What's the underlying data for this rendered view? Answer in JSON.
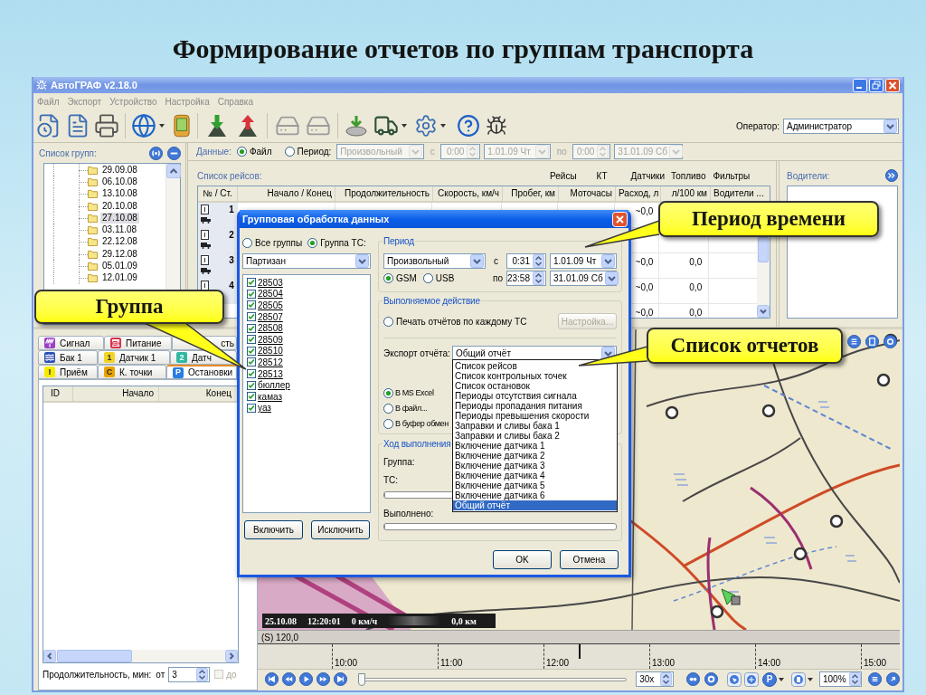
{
  "slide": {
    "title": "Формирование отчетов по группам транспорта"
  },
  "window": {
    "title": "АвтоГРАФ v2.18.0"
  },
  "menu": [
    "Файл",
    "Экспорт",
    "Устройство",
    "Настройка",
    "Справка"
  ],
  "toolbar": {
    "operator_label": "Оператор:",
    "operator": "Администратор"
  },
  "group_list": {
    "title": "Список групп:",
    "items": [
      {
        "label": "29.09.08",
        "selected": false
      },
      {
        "label": "06.10.08",
        "selected": false
      },
      {
        "label": "13.10.08",
        "selected": false
      },
      {
        "label": "20.10.08",
        "selected": false
      },
      {
        "label": "27.10.08",
        "selected": true
      },
      {
        "label": "03.11.08",
        "selected": false
      },
      {
        "label": "22.12.08",
        "selected": false
      },
      {
        "label": "29.12.08",
        "selected": false
      },
      {
        "label": "05.01.09",
        "selected": false
      },
      {
        "label": "12.01.09",
        "selected": false
      }
    ]
  },
  "data_bar": {
    "label": "Данные:",
    "sources": [
      {
        "label": "Файл",
        "selected": true
      },
      {
        "label": "Период:",
        "selected": false
      }
    ],
    "disabled": true,
    "period": "Произвольный",
    "from_label": "с",
    "from_time": "0:00",
    "from_date": "1.01.09 Чт",
    "to_label": "по",
    "to_time": "0:00",
    "to_date": "31.01.09 Сб"
  },
  "trips": {
    "title": "Список рейсов:",
    "column_groups": [
      "Рейсы",
      "КТ",
      "Датчики",
      "Топливо",
      "Фильтры"
    ],
    "columns": [
      "№ / Ст.",
      "Начало / Конец",
      "Продолжительность",
      "Скорость, км/ч",
      "Пробег, км",
      "Моточасы",
      "Расход, л",
      "л/100 км",
      "Водители ..."
    ],
    "rows": [
      {
        "number": "1",
        "fuel": "~0,0"
      },
      {
        "number": "2"
      },
      {
        "number": "3",
        "fuel": "~0,0",
        "per_100km": "0,0"
      },
      {
        "number": "4",
        "fuel": "~0,0",
        "per_100km": "0,0"
      },
      {
        "fuel": "~0,0",
        "per_100km": "0,0"
      }
    ]
  },
  "drivers": {
    "title": "Водители:"
  },
  "event_tabs": [
    [
      {
        "label": "Сигнал",
        "selected": false
      },
      {
        "label": "Питание",
        "selected": false
      },
      {
        "label": "сть",
        "selected": false,
        "cut_start": true
      }
    ],
    [
      {
        "label": "Бак 1",
        "selected": false
      },
      {
        "label": "Датчик 1",
        "badge": "1",
        "selected": false
      },
      {
        "label": "Датч",
        "badge": "2",
        "selected": false
      }
    ],
    [
      {
        "label": "Приём",
        "badge": "!",
        "selected": false
      },
      {
        "label": "К. точки",
        "badge": "C",
        "selected": false
      },
      {
        "label": "Остановки",
        "badge": "P",
        "selected": true
      }
    ]
  ],
  "stops_table": {
    "columns": [
      "ID",
      "Начало",
      "Конец"
    ]
  },
  "duration_filter": {
    "label": "Продолжительность, мин:",
    "from_label": "от",
    "from_value": "3",
    "to_label": "до",
    "to_checked": false,
    "to_disabled": true
  },
  "map": {
    "overlay": {
      "date": "25.10.08",
      "time": "12:20:01",
      "speed": "0 км/ч",
      "distance": "0,0 км"
    }
  },
  "timeline": {
    "label": "(S) 120,0",
    "ticks": [
      "10:00",
      "11:00",
      "12:00",
      "13:00",
      "14:00",
      "15:00"
    ]
  },
  "playback": {
    "position": {
      "level": 0
    },
    "speed": "30x",
    "parking_badge": "P",
    "zoom": "100%"
  },
  "dialog": {
    "title": "Групповая обработка данных",
    "scope": [
      {
        "label": "Все группы",
        "selected": false
      },
      {
        "label": "Группа ТС:",
        "selected": true
      }
    ],
    "group": "Партизан",
    "vehicles": [
      {
        "label": "28503",
        "checked": true
      },
      {
        "label": "28504",
        "checked": true
      },
      {
        "label": "28505",
        "checked": true
      },
      {
        "label": "28507",
        "checked": true
      },
      {
        "label": "28508",
        "checked": true
      },
      {
        "label": "28509",
        "checked": true
      },
      {
        "label": "28510",
        "checked": true
      },
      {
        "label": "28512",
        "checked": true
      },
      {
        "label": "28513",
        "checked": true
      },
      {
        "label": "бюллер",
        "checked": true
      },
      {
        "label": "камаз",
        "checked": true
      },
      {
        "label": "уаз",
        "checked": true
      }
    ],
    "list_buttons": [
      "Включить",
      "Исключить"
    ],
    "period": {
      "title": "Период",
      "mode": "Произвольный",
      "from_label": "с",
      "from_time": "0:31",
      "from_date": "1.01.09 Чт",
      "to_label": "по",
      "to_time": "23:58",
      "to_date": "31.01.09 Сб",
      "sources": [
        {
          "label": "GSM",
          "selected": true
        },
        {
          "label": "USB",
          "selected": false
        }
      ]
    },
    "action": {
      "title": "Выполняемое действие",
      "print_option": {
        "label": "Печать отчётов по каждому ТС",
        "selected": false
      },
      "settings_button": {
        "label": "Настройка...",
        "disabled": true
      },
      "export_label": "Экспорт отчёта:",
      "export_value": "Общий отчёт",
      "export_options": [
        {
          "label": "Список рейсов",
          "selected": false
        },
        {
          "label": "Список контрольных точек",
          "selected": false
        },
        {
          "label": "Список остановок",
          "selected": false
        },
        {
          "label": "Периоды отсутствия сигнала",
          "selected": false
        },
        {
          "label": "Периоды пропадания питания",
          "selected": false
        },
        {
          "label": "Периоды превышения скорости",
          "selected": false
        },
        {
          "label": "Заправки и сливы бака 1",
          "selected": false
        },
        {
          "label": "Заправки и сливы бака 2",
          "selected": false
        },
        {
          "label": "Включение датчика 1",
          "selected": false
        },
        {
          "label": "Включение датчика 2",
          "selected": false
        },
        {
          "label": "Включение датчика 3",
          "selected": false
        },
        {
          "label": "Включение датчика 4",
          "selected": false
        },
        {
          "label": "Включение датчика 5",
          "selected": false
        },
        {
          "label": "Включение датчика 6",
          "selected": false
        },
        {
          "label": "Общий отчёт",
          "selected": true
        }
      ],
      "targets": [
        {
          "label": "В MS Excel",
          "selected": true
        },
        {
          "label": "В файл...",
          "selected": false
        },
        {
          "label": "В буфер обмен",
          "selected": false
        }
      ]
    },
    "progress": {
      "title": "Ход выполнения",
      "group_label": "Группа:",
      "vehicle_label": "ТС:",
      "vehicle_bar": {
        "level": 0
      },
      "done_label": "Выполнено:",
      "done_bar": {
        "level": 0
      }
    },
    "buttons": [
      "OK",
      "Отмена"
    ]
  },
  "callouts": [
    "Группа",
    "Период времени",
    "Список отчетов"
  ]
}
